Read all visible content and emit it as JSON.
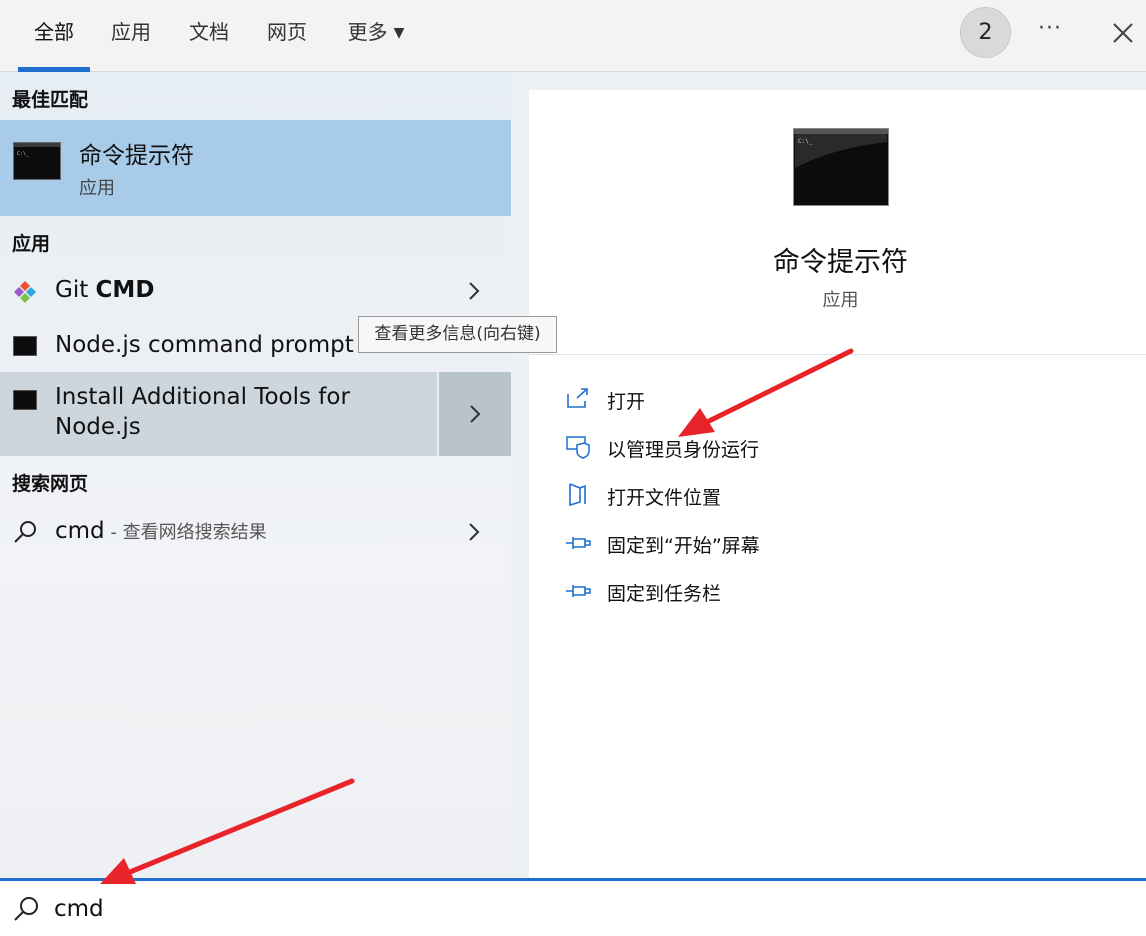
{
  "tabs": [
    {
      "label": "全部",
      "active": true
    },
    {
      "label": "应用"
    },
    {
      "label": "文档"
    },
    {
      "label": "网页"
    },
    {
      "label": "更多"
    }
  ],
  "header": {
    "badge": "2",
    "more_label": "···"
  },
  "left": {
    "best_match_title": "最佳匹配",
    "best_match": {
      "title": "命令提示符",
      "subtitle": "应用"
    },
    "apps_title": "应用",
    "apps": [
      {
        "label_prefix": "Git ",
        "label_bold": "CMD"
      },
      {
        "label": "Node.js command prompt"
      },
      {
        "label_line1": "Install Additional Tools for",
        "label_line2": "Node.js"
      }
    ],
    "web_title": "搜索网页",
    "web": {
      "query": "cmd",
      "suffix": " - 查看网络搜索结果"
    },
    "tooltip": "查看更多信息(向右键)"
  },
  "right": {
    "title": "命令提示符",
    "subtitle": "应用",
    "actions": [
      {
        "label": "打开",
        "icon": "open-icon"
      },
      {
        "label": "以管理员身份运行",
        "icon": "shield-icon"
      },
      {
        "label": "打开文件位置",
        "icon": "folder-icon"
      },
      {
        "label": "固定到“开始”屏幕",
        "icon": "pin-icon"
      },
      {
        "label": "固定到任务栏",
        "icon": "pin-icon"
      }
    ]
  },
  "search": {
    "value": "cmd"
  },
  "colors": {
    "accent": "#1f6fd1",
    "selected": "#a8cbe9",
    "arrow": "#e8232a"
  }
}
